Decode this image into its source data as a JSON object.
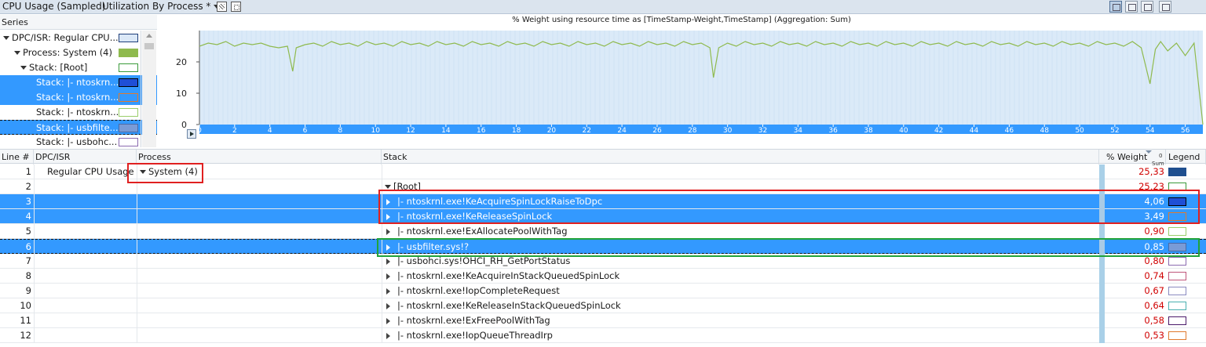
{
  "window": {
    "title": "CPU Usage (Sampled)",
    "preset": "Utilization By Process *",
    "toolbar_icons": [
      "graph-only-icon",
      "graph-table-icon",
      "table-only-icon",
      "chart-settings-icon"
    ]
  },
  "series": {
    "header": "Series",
    "items": [
      {
        "label": "DPC/ISR: Regular CPU...",
        "indent": 0,
        "expanded": true,
        "state": "normal",
        "swatch": "#dbe8f7",
        "swatch_border": "#1f3f7a"
      },
      {
        "label": "Process: System (4)",
        "indent": 1,
        "expanded": true,
        "state": "normal",
        "swatch": "#8fba4e",
        "swatch_border": "#8fba4e"
      },
      {
        "label": "Stack: [Root]",
        "indent": 2,
        "expanded": true,
        "state": "normal",
        "swatch": "#ffffff",
        "swatch_border": "#3a9a3a"
      },
      {
        "label": "Stack:  |- ntoskrn...",
        "indent": 3,
        "expanded": false,
        "state": "selected",
        "swatch": "#1f4fd6",
        "swatch_border": "#000000"
      },
      {
        "label": "Stack:  |- ntoskrn...",
        "indent": 3,
        "expanded": false,
        "state": "selected",
        "swatch": "#3399ff",
        "swatch_border": "#e07a2e"
      },
      {
        "label": "Stack:  |- ntoskrn...",
        "indent": 3,
        "expanded": false,
        "state": "normal",
        "swatch": "#ffffff",
        "swatch_border": "#9acd6a"
      },
      {
        "label": "Stack:  |- usbfilte...",
        "indent": 3,
        "expanded": false,
        "state": "selected-dashed",
        "swatch": "#7a9bd6",
        "swatch_border": "#4a6aa6"
      },
      {
        "label": "Stack:  |- usbohc...",
        "indent": 3,
        "expanded": false,
        "state": "normal",
        "swatch": "#ffffff",
        "swatch_border": "#8a6ab0"
      }
    ]
  },
  "chart_data": {
    "type": "line",
    "title": "% Weight using resource time as [TimeStamp-Weight,TimeStamp] (Aggregation: Sum)",
    "xlabel": "",
    "ylabel": "",
    "xlim": [
      0,
      57
    ],
    "ylim": [
      0,
      30
    ],
    "x_ticks": [
      0,
      2,
      4,
      6,
      8,
      10,
      12,
      14,
      16,
      18,
      20,
      22,
      24,
      26,
      28,
      30,
      32,
      34,
      36,
      38,
      40,
      42,
      44,
      46,
      48,
      50,
      52,
      54,
      56
    ],
    "y_ticks": [
      0,
      10,
      20
    ],
    "grid": false,
    "series": [
      {
        "color": "#8fba4e",
        "x": [
          0,
          0.5,
          1,
          1.5,
          2,
          2.5,
          3,
          3.5,
          4,
          4.5,
          5,
          5.3,
          5.5,
          6,
          6.5,
          7,
          7.5,
          8,
          8.5,
          9,
          9.5,
          10,
          10.5,
          11,
          11.5,
          12,
          12.5,
          13,
          13.5,
          14,
          14.5,
          15,
          15.5,
          16,
          16.5,
          17,
          17.5,
          18,
          18.5,
          19,
          19.5,
          20,
          20.5,
          21,
          21.5,
          22,
          22.5,
          23,
          23.5,
          24,
          24.5,
          25,
          25.5,
          26,
          26.5,
          27,
          27.5,
          28,
          28.5,
          29,
          29.2,
          29.5,
          30,
          30.5,
          31,
          31.5,
          32,
          32.5,
          33,
          33.5,
          34,
          34.5,
          35,
          35.5,
          36,
          36.5,
          37,
          37.5,
          38,
          38.5,
          39,
          39.5,
          40,
          40.5,
          41,
          41.5,
          42,
          42.5,
          43,
          43.5,
          44,
          44.5,
          45,
          45.5,
          46,
          46.5,
          47,
          47.5,
          48,
          48.5,
          49,
          49.5,
          50,
          50.5,
          51,
          51.5,
          52,
          52.5,
          53,
          53.5,
          54,
          54.3,
          54.6,
          55,
          55.5,
          56,
          56.5,
          57
        ],
        "values": [
          25,
          26,
          25.5,
          26.5,
          25,
          26,
          25.5,
          26,
          25,
          24.5,
          25,
          17,
          24.5,
          25.5,
          26,
          25,
          26.5,
          25.5,
          26,
          25,
          26.5,
          25.5,
          26,
          25,
          26.5,
          25.5,
          26,
          25,
          26.5,
          25.5,
          26,
          25,
          26.5,
          25.5,
          26,
          25,
          26.5,
          25.5,
          26,
          25,
          26.5,
          25.5,
          26,
          25,
          26.5,
          25.5,
          26,
          25,
          26.5,
          25.5,
          26,
          25,
          26.5,
          25.5,
          26,
          25,
          26.5,
          25.5,
          26,
          24.5,
          15,
          24.5,
          26,
          25,
          26.5,
          25.5,
          26,
          25,
          26.5,
          25.5,
          26,
          25,
          26.5,
          25.5,
          26,
          25,
          26.5,
          25.5,
          26,
          25,
          26.5,
          25.5,
          26,
          25,
          26.5,
          25.5,
          26,
          25,
          26.5,
          25.5,
          26,
          25,
          26.5,
          25.5,
          26,
          25,
          26.5,
          25.5,
          26,
          25,
          26.5,
          25.5,
          26,
          25,
          26.5,
          25.5,
          26,
          25,
          26.5,
          24.5,
          13,
          24,
          26.5,
          23.5,
          26,
          22,
          26,
          0
        ]
      }
    ]
  },
  "table": {
    "columns": {
      "line": "Line #",
      "dpc": "DPC/ISR",
      "process": "Process",
      "stack": "Stack",
      "weight": "% Weight",
      "weight_sub": "Sum",
      "weight_sort": "0",
      "legend": "Legend"
    },
    "rows": [
      {
        "line": "1",
        "dpc": "Regular CPU Usage",
        "process": "System (4)",
        "stack": "",
        "stack_indent": 0,
        "stack_exp": "none",
        "weight": "25,33",
        "state": "normal",
        "swatch": "#1f4f8f",
        "swatch_border": "#1f4f8f"
      },
      {
        "line": "2",
        "dpc": "",
        "process": "",
        "stack": "[Root]",
        "stack_indent": 0,
        "stack_exp": "down",
        "weight": "25,23",
        "state": "normal",
        "swatch": "#ffffff",
        "swatch_border": "#3a9a3a"
      },
      {
        "line": "3",
        "dpc": "",
        "process": "",
        "stack": "|- ntoskrnl.exe!KeAcquireSpinLockRaiseToDpc",
        "stack_indent": 1,
        "stack_exp": "right",
        "weight": "4,06",
        "state": "selected",
        "swatch": "#1f4fd6",
        "swatch_border": "#000000"
      },
      {
        "line": "4",
        "dpc": "",
        "process": "",
        "stack": "|- ntoskrnl.exe!KeReleaseSpinLock",
        "stack_indent": 1,
        "stack_exp": "right",
        "weight": "3,49",
        "state": "selected",
        "swatch": "#3399ff",
        "swatch_border": "#e07a2e"
      },
      {
        "line": "5",
        "dpc": "",
        "process": "",
        "stack": "|- ntoskrnl.exe!ExAllocatePoolWithTag",
        "stack_indent": 1,
        "stack_exp": "right",
        "weight": "0,90",
        "state": "normal",
        "swatch": "#ffffff",
        "swatch_border": "#9acd6a"
      },
      {
        "line": "6",
        "dpc": "",
        "process": "",
        "stack": "|- usbfilter.sys!?",
        "stack_indent": 1,
        "stack_exp": "right",
        "weight": "0,85",
        "state": "selected-dashed",
        "swatch": "#7a9bd6",
        "swatch_border": "#4a6aa6"
      },
      {
        "line": "7",
        "dpc": "",
        "process": "",
        "stack": "|- usbohci.sys!OHCI_RH_GetPortStatus",
        "stack_indent": 1,
        "stack_exp": "right",
        "weight": "0,80",
        "state": "normal",
        "swatch": "#ffffff",
        "swatch_border": "#8a6ab0"
      },
      {
        "line": "8",
        "dpc": "",
        "process": "",
        "stack": "|- ntoskrnl.exe!KeAcquireInStackQueuedSpinLock",
        "stack_indent": 1,
        "stack_exp": "right",
        "weight": "0,74",
        "state": "normal",
        "swatch": "#ffffff",
        "swatch_border": "#c0557a"
      },
      {
        "line": "9",
        "dpc": "",
        "process": "",
        "stack": "|- ntoskrnl.exe!IopCompleteRequest",
        "stack_indent": 1,
        "stack_exp": "right",
        "weight": "0,67",
        "state": "normal",
        "swatch": "#ffffff",
        "swatch_border": "#8a8ac0"
      },
      {
        "line": "10",
        "dpc": "",
        "process": "",
        "stack": "|- ntoskrnl.exe!KeReleaseInStackQueuedSpinLock",
        "stack_indent": 1,
        "stack_exp": "right",
        "weight": "0,64",
        "state": "normal",
        "swatch": "#ffffff",
        "swatch_border": "#4ab0b0"
      },
      {
        "line": "11",
        "dpc": "",
        "process": "",
        "stack": "|- ntoskrnl.exe!ExFreePoolWithTag",
        "stack_indent": 1,
        "stack_exp": "right",
        "weight": "0,58",
        "state": "normal",
        "swatch": "#ffffff",
        "swatch_border": "#4a1a6a"
      },
      {
        "line": "12",
        "dpc": "",
        "process": "",
        "stack": "|- ntoskrnl.exe!IopQueueThreadIrp",
        "stack_indent": 1,
        "stack_exp": "right",
        "weight": "0,53",
        "state": "normal",
        "swatch": "#ffffff",
        "swatch_border": "#e07a2e"
      }
    ]
  },
  "colors": {
    "selection": "#3399ff",
    "weight_text": "#d00000",
    "plot_bg": "#dbeaf8",
    "highlight_red": "#e02020",
    "highlight_green": "#21a33a"
  }
}
